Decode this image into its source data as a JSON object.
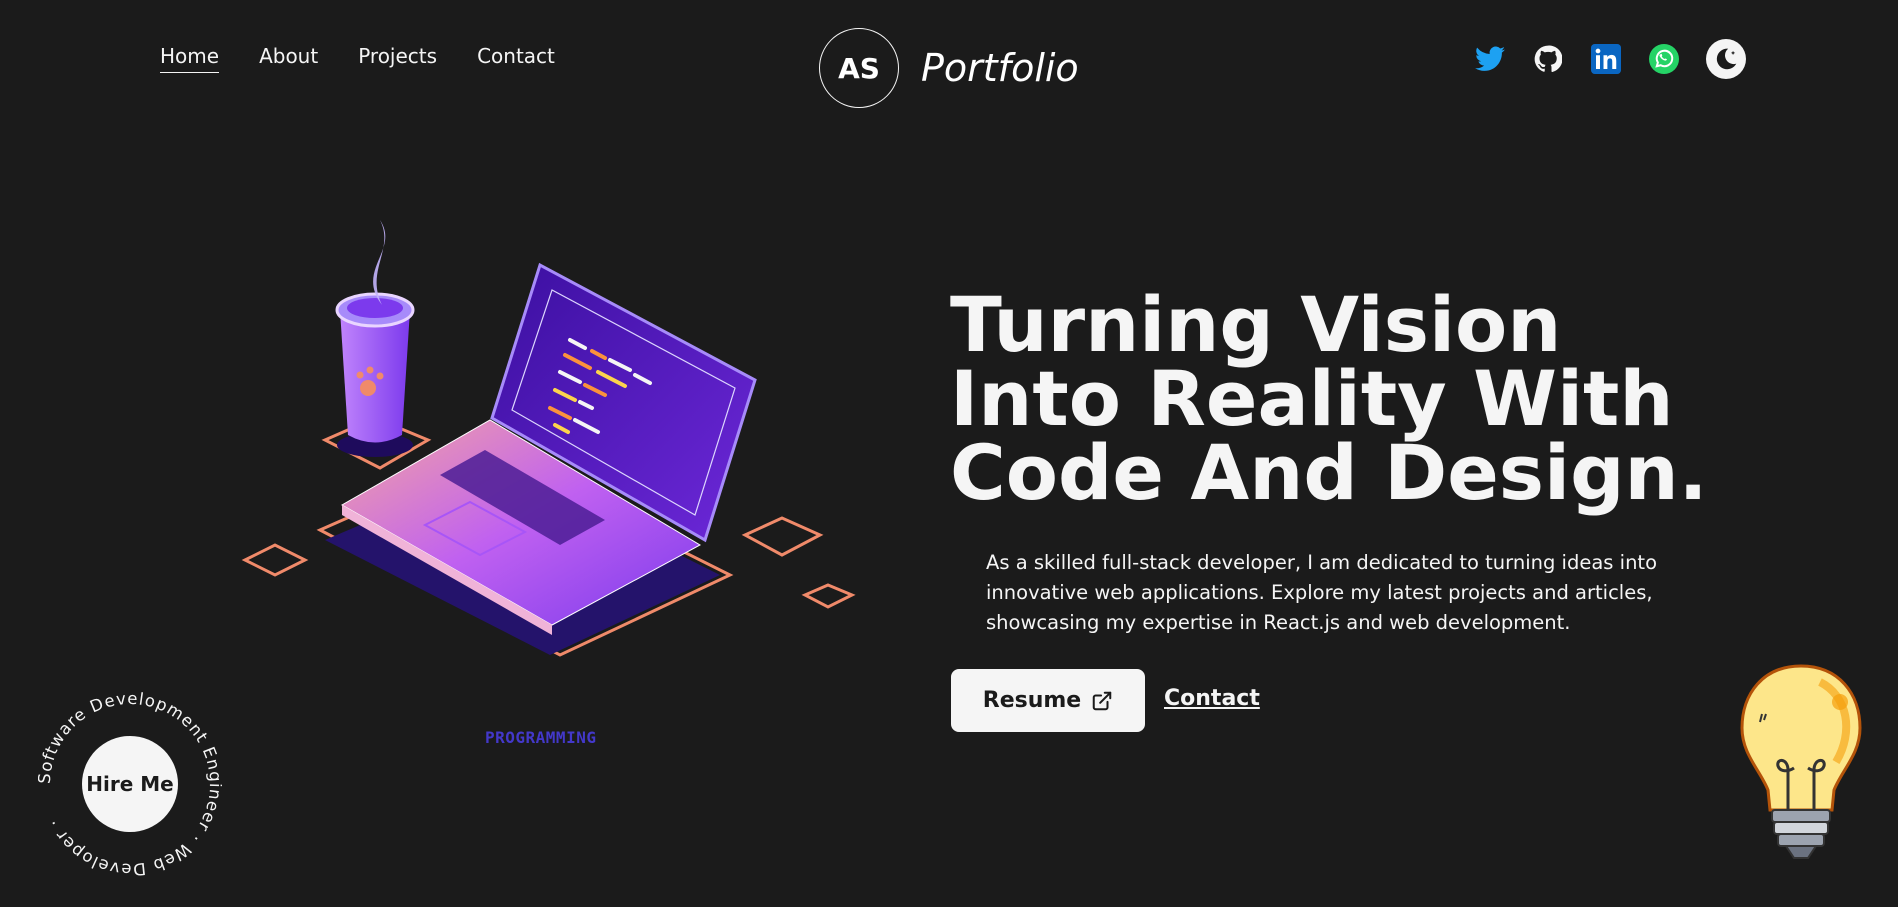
{
  "nav": {
    "items": [
      {
        "label": "Home",
        "active": true
      },
      {
        "label": "About",
        "active": false
      },
      {
        "label": "Projects",
        "active": false
      },
      {
        "label": "Contact",
        "active": false
      }
    ]
  },
  "brand": {
    "initials": "AS",
    "name": "Portfolio"
  },
  "socials": [
    "twitter-icon",
    "github-icon",
    "linkedin-icon",
    "whatsapp-icon"
  ],
  "theme_toggle": {
    "icon": "moon-icon"
  },
  "hero": {
    "headline": "Turning Vision Into Reality With Code And Design.",
    "description": "As a skilled full-stack developer, I am dedicated to turning ideas into innovative web applications. Explore my latest projects and articles, showcasing my expertise in React.js and web development.",
    "resume_label": "Resume",
    "contact_label": "Contact",
    "illustration_caption": "PROGRAMMING"
  },
  "hire_badge": {
    "button_label": "Hire Me",
    "ring_text": "Software Development Engineer · Web Developer ·"
  },
  "colors": {
    "background": "#1b1b1b",
    "text": "#f5f5f5",
    "accent_purple": "#7c3aed",
    "accent_orange": "#f08a6a",
    "twitter": "#1da1f2",
    "linkedin": "#0a66c2",
    "whatsapp": "#25d366"
  }
}
